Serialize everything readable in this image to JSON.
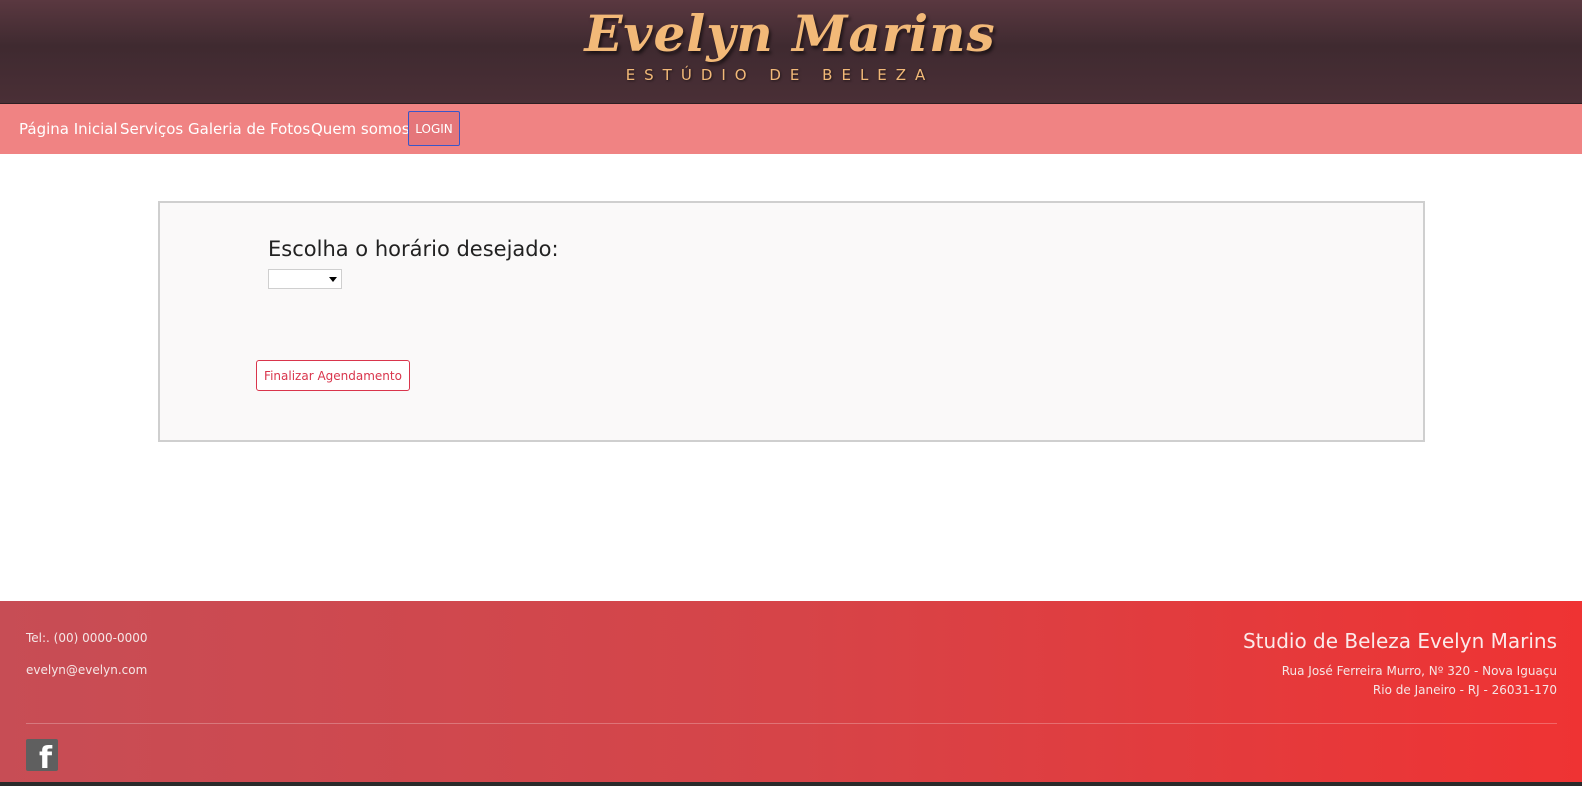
{
  "header": {
    "logo_script": "Evelyn Marins",
    "logo_subtitle": "ESTÚDIO DE BELEZA"
  },
  "nav": {
    "items": [
      {
        "label": "Página Inicial"
      },
      {
        "label": "Serviços"
      },
      {
        "label": "Galeria de Fotos"
      },
      {
        "label": "Quem somos"
      }
    ],
    "login_label": "LOGIN"
  },
  "form": {
    "time_label": "Escolha o horário desejado:",
    "time_selected": "",
    "submit_label": "Finalizar Agendamento"
  },
  "footer": {
    "phone": "Tel:. (00) 0000-0000",
    "email": "evelyn@evelyn.com",
    "studio_name": "Studio de Beleza Evelyn Marins",
    "address_line1": "Rua José Ferreira Murro, Nº 320 - Nova Iguaçu",
    "address_line2": "Rio de Janeiro - RJ - 26031-170",
    "social_icon": "facebook-icon"
  },
  "colors": {
    "header_bg": "#4a2f36",
    "logo_gold": "#f2b978",
    "nav_bg": "#f08383",
    "accent_red": "#d9354c",
    "footer_start": "#c74d55",
    "footer_end": "#ef3333"
  }
}
